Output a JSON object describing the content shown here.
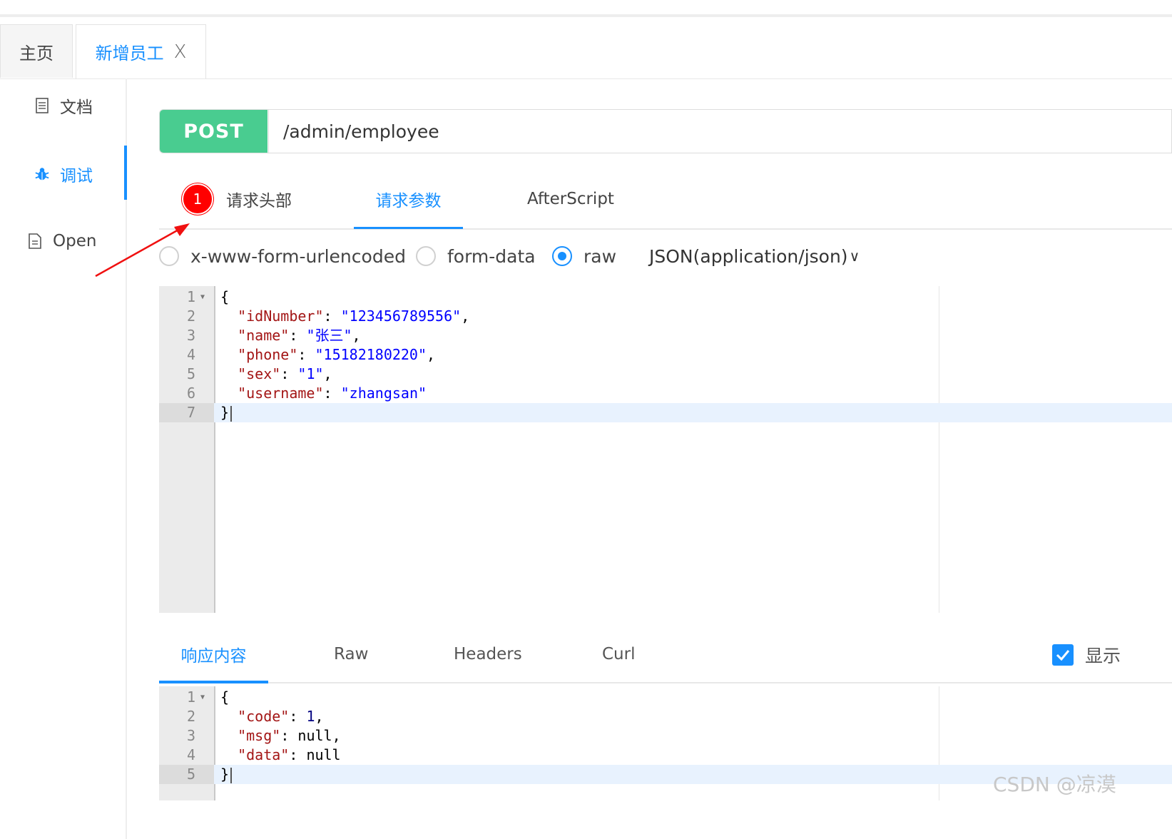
{
  "tabs": [
    {
      "label": "主页"
    },
    {
      "label": "新增员工",
      "close": "X"
    }
  ],
  "sidebar": {
    "items": [
      {
        "label": "文档",
        "icon": "document-icon"
      },
      {
        "label": "调试",
        "icon": "bug-icon"
      },
      {
        "label": "Open",
        "icon": "file-icon"
      }
    ]
  },
  "request": {
    "method": "POST",
    "url": "/admin/employee",
    "tabs": {
      "headers_badge": "1",
      "headers": "请求头部",
      "params": "请求参数",
      "after_script": "AfterScript"
    },
    "body_types": [
      "x-www-form-urlencoded",
      "form-data",
      "raw"
    ],
    "content_type": "JSON(application/json)",
    "content_type_caret": "∨"
  },
  "request_body": {
    "line_numbers": [
      "1",
      "2",
      "3",
      "4",
      "5",
      "6",
      "7"
    ],
    "lines": [
      {
        "k": "",
        "v": "{"
      },
      {
        "k": "\"idNumber\"",
        "v": "\"123456789556\"",
        "tail": ","
      },
      {
        "k": "\"name\"",
        "v": "\"张三\"",
        "tail": ","
      },
      {
        "k": "\"phone\"",
        "v": "\"15182180220\"",
        "tail": ","
      },
      {
        "k": "\"sex\"",
        "v": "\"1\"",
        "tail": ","
      },
      {
        "k": "\"username\"",
        "v": "\"zhangsan\"",
        "tail": ""
      },
      {
        "k": "",
        "v": "}"
      }
    ]
  },
  "response": {
    "tabs": [
      "响应内容",
      "Raw",
      "Headers",
      "Curl"
    ],
    "checkbox_label": "显示",
    "line_numbers": [
      "1",
      "2",
      "3",
      "4",
      "5"
    ],
    "lines": [
      {
        "k": "",
        "v": "{"
      },
      {
        "k": "\"code\"",
        "v": "1",
        "tail": ","
      },
      {
        "k": "\"msg\"",
        "v": "null",
        "tail": ","
      },
      {
        "k": "\"data\"",
        "v": "null",
        "tail": ""
      },
      {
        "k": "",
        "v": "}"
      }
    ]
  },
  "watermark": "CSDN @凉漠",
  "colors": {
    "accent": "#1890ff",
    "method_bg": "#49cc90",
    "badge": "#ff0000",
    "json_key": "#a31515",
    "json_string": "#0000ff"
  }
}
